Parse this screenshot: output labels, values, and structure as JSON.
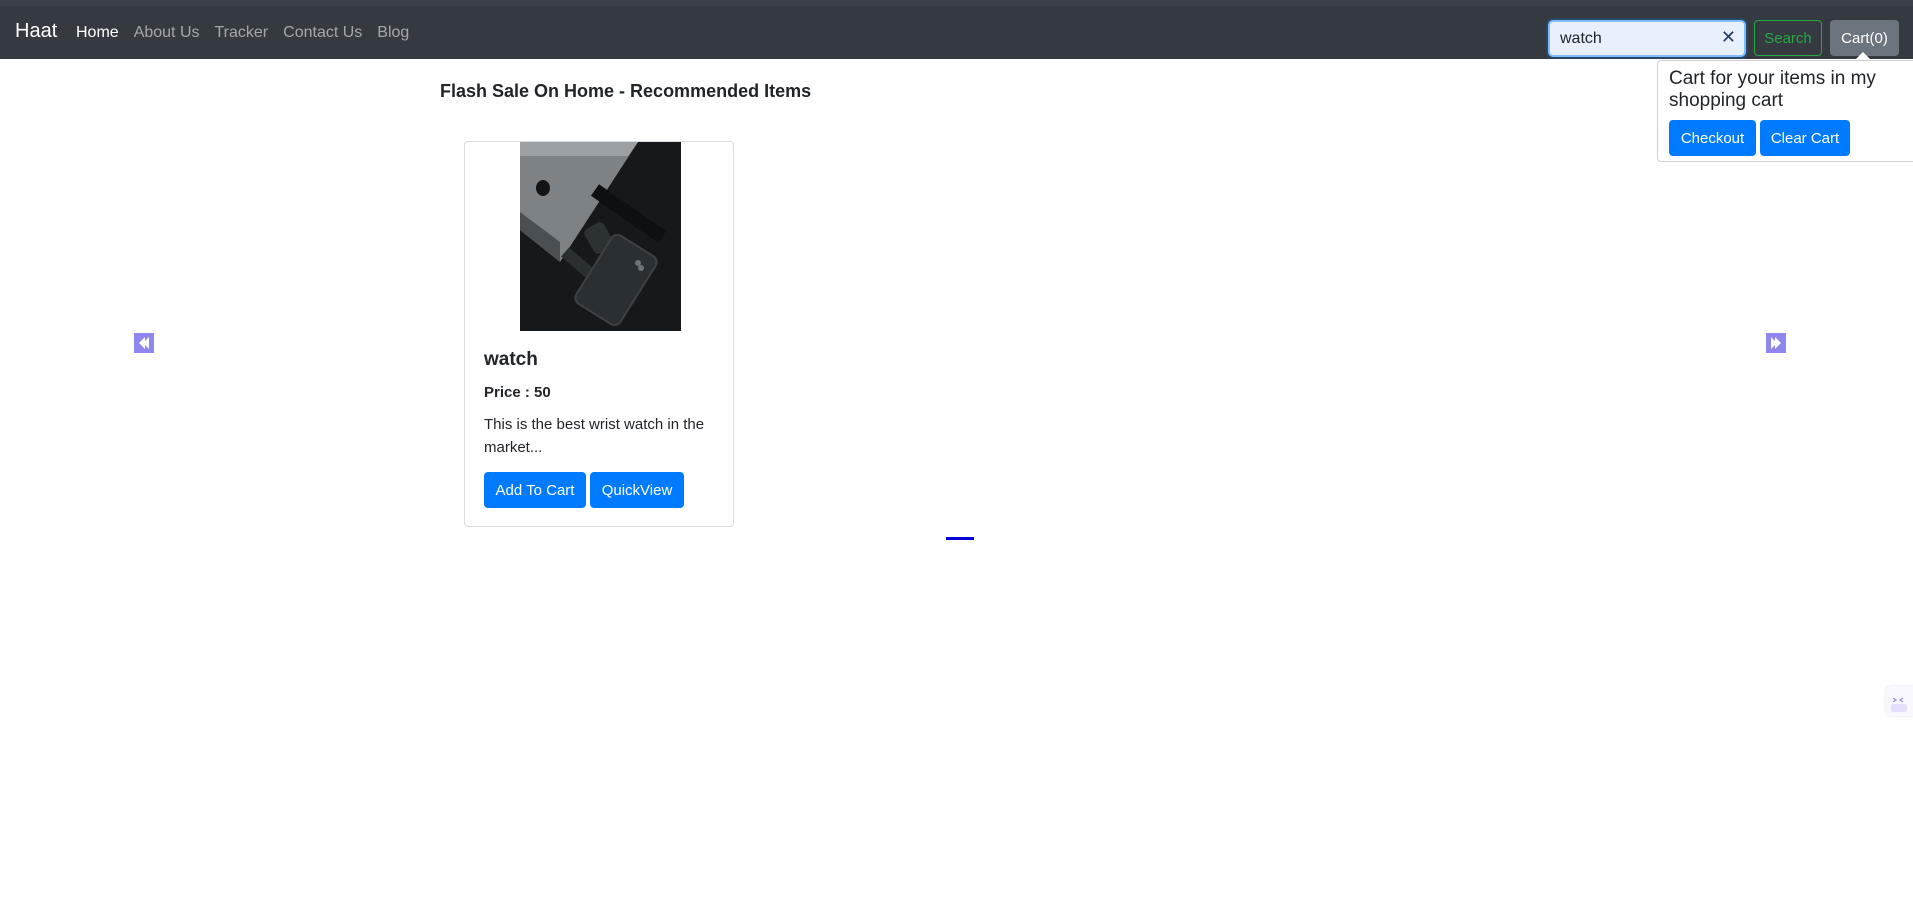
{
  "navbar": {
    "brand": "Haat",
    "links": [
      {
        "label": "Home",
        "active": true
      },
      {
        "label": "About Us",
        "active": false
      },
      {
        "label": "Tracker",
        "active": false
      },
      {
        "label": "Contact Us",
        "active": false
      },
      {
        "label": "Blog",
        "active": false
      }
    ],
    "search": {
      "value": "watch",
      "clear_icon": "close-icon"
    },
    "search_button": "Search",
    "cart_button": "Cart(0)"
  },
  "cart_popover": {
    "title": "Cart for your items in my shopping cart",
    "checkout_button": "Checkout",
    "clear_button": "Clear Cart"
  },
  "main": {
    "section_title": "Flash Sale On Home - Recommended Items",
    "products": [
      {
        "name": "watch",
        "price": "Price : 50",
        "description": "This is the best wrist watch in the market...",
        "add_to_cart": "Add To Cart",
        "quick_view": "QuickView",
        "image": "product-photo-laptop-watch-phone"
      }
    ],
    "carousel": {
      "prev_icon": "chevron-left-icon",
      "next_icon": "chevron-right-icon",
      "slides": 1,
      "active_slide": 1
    }
  },
  "colors": {
    "navbar_bg": "#343a40",
    "primary": "#007bff",
    "success": "#28a745",
    "secondary": "#6c757d",
    "carousel_control": "#8f86f0",
    "indicator": "#0000dd"
  }
}
